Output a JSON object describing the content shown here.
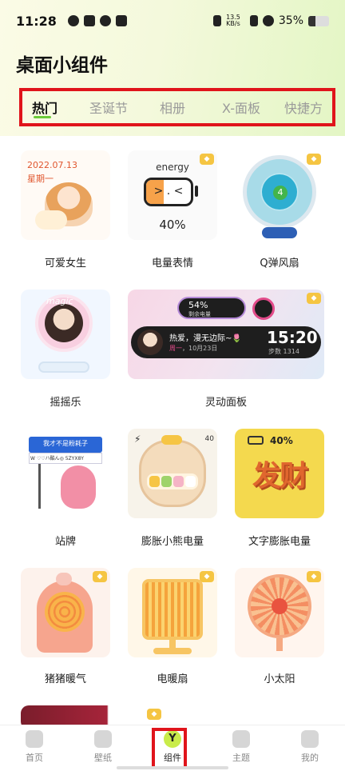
{
  "status_bar": {
    "time": "11:28",
    "net_speed_value": "13.5",
    "net_speed_unit": "KB/s",
    "battery": "35%",
    "battery_level": 0.35
  },
  "page": {
    "title": "桌面小组件"
  },
  "tabs": [
    {
      "label": "热门",
      "active": true
    },
    {
      "label": "圣诞节"
    },
    {
      "label": "相册"
    },
    {
      "label": "X-面板"
    },
    {
      "label": "快捷方"
    }
  ],
  "widgets": [
    {
      "name": "可爱女生",
      "date": "2022.07.13",
      "weekday": "星期一"
    },
    {
      "name": "电量表情",
      "text": "energy",
      "face": "> . <",
      "percent": "40%",
      "level": 0.4
    },
    {
      "name": "Q弹风扇",
      "badge_num": "4"
    },
    {
      "name": "摇摇乐",
      "magic": "magic"
    },
    {
      "name": "灵动面板",
      "battery_pct": "54%",
      "battery_sub": "剩余电量",
      "message": "热爱，漫无边际~🌷",
      "weekday": "周一",
      "date": "10月23日",
      "time": "15:20",
      "steps_label": "步数",
      "steps": "1314"
    },
    {
      "name": "站牌",
      "sign_title": "我才不是粉耗子",
      "sign_text": "W ♡♡ハ酷ん◎ 5ZYX8Y"
    },
    {
      "name": "膨胀小熊电量",
      "percent": "40"
    },
    {
      "name": "文字膨胀电量",
      "percent": "40%",
      "big_text": "发财"
    },
    {
      "name": "猪猪暖气"
    },
    {
      "name": "电暖扇"
    },
    {
      "name": "小太阳"
    }
  ],
  "nav": [
    {
      "label": "首页"
    },
    {
      "label": "壁纸"
    },
    {
      "label": "组件",
      "active": true,
      "icon_letter": "Y"
    },
    {
      "label": "主题"
    },
    {
      "label": "我的"
    }
  ],
  "colors": {
    "accent_red": "#e0141b",
    "accent_green": "#6ccb3a",
    "nav_active": "#c9ec4a"
  }
}
